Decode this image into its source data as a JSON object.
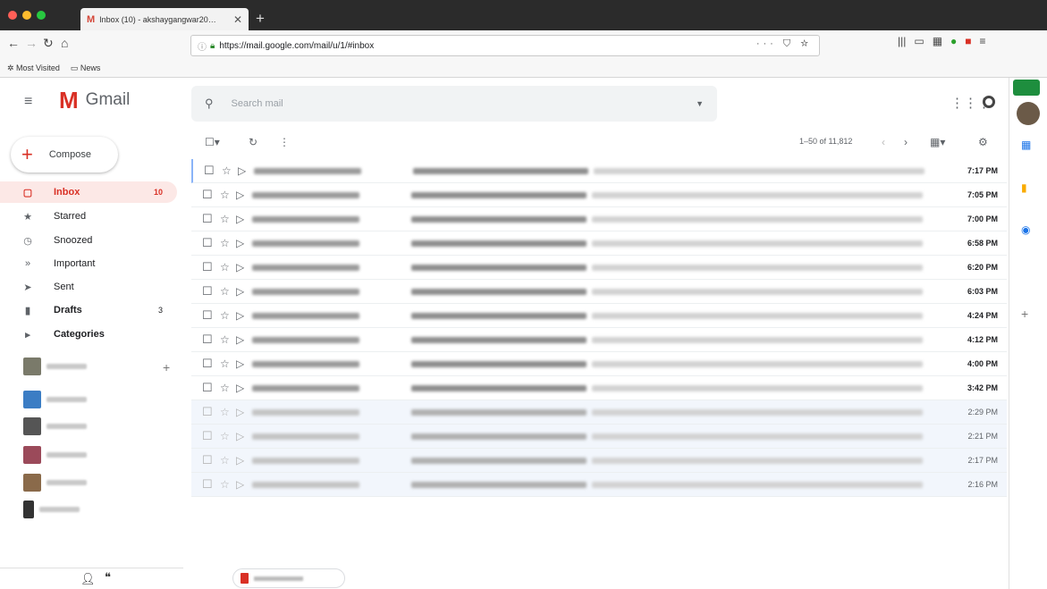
{
  "browser": {
    "tab_title": "Inbox (10) - akshaygangwar20…",
    "url": "https://mail.google.com/mail/u/1/#inbox",
    "bookmarks": [
      "Most Visited",
      "News"
    ]
  },
  "header": {
    "app_name": "Gmail",
    "search_placeholder": "Search mail"
  },
  "compose_label": "Compose",
  "sidebar": {
    "items": [
      {
        "label": "Inbox",
        "count": "10",
        "icon": "inbox-icon",
        "active": true
      },
      {
        "label": "Starred",
        "count": "",
        "icon": "star-icon"
      },
      {
        "label": "Snoozed",
        "count": "",
        "icon": "clock-icon"
      },
      {
        "label": "Important",
        "count": "",
        "icon": "important-icon"
      },
      {
        "label": "Sent",
        "count": "",
        "icon": "send-icon"
      },
      {
        "label": "Drafts",
        "count": "3",
        "icon": "draft-icon",
        "bold": true
      },
      {
        "label": "Categories",
        "count": "",
        "icon": "label-icon",
        "bold": true
      }
    ]
  },
  "pager": "1–50 of 11,812",
  "emails": [
    {
      "time": "7:17 PM",
      "read": false
    },
    {
      "time": "7:05 PM",
      "read": false
    },
    {
      "time": "7:00 PM",
      "read": false
    },
    {
      "time": "6:58 PM",
      "read": false
    },
    {
      "time": "6:20 PM",
      "read": false
    },
    {
      "time": "6:03 PM",
      "read": false
    },
    {
      "time": "4:24 PM",
      "read": false
    },
    {
      "time": "4:12 PM",
      "read": false
    },
    {
      "time": "4:00 PM",
      "read": false
    },
    {
      "time": "3:42 PM",
      "read": false
    },
    {
      "time": "2:29 PM",
      "read": true
    },
    {
      "time": "2:21 PM",
      "read": true
    },
    {
      "time": "2:17 PM",
      "read": true
    },
    {
      "time": "2:16 PM",
      "read": true
    }
  ],
  "colors": {
    "accent": "#d93025",
    "active_bg": "#fce8e6",
    "read_row": "#f2f6fc"
  }
}
